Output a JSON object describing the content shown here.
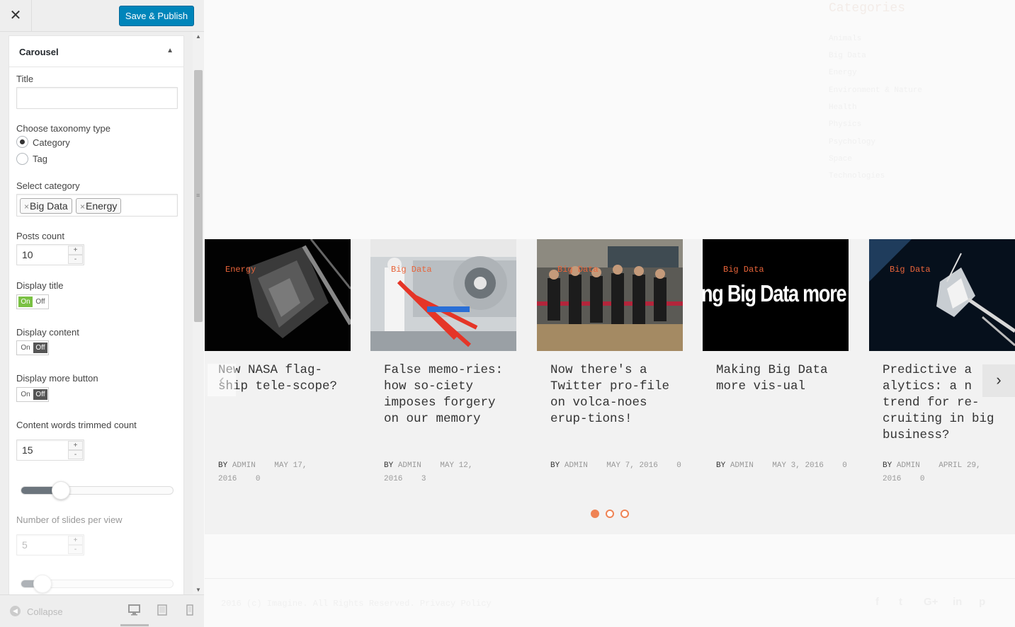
{
  "topbar": {
    "close_icon": "close-icon",
    "save_label": "Save & Publish"
  },
  "widget": {
    "title": "Carousel",
    "fields": {
      "title_label": "Title",
      "title_value": "",
      "taxonomy_label": "Choose taxonomy type",
      "taxonomy_options": [
        "Category",
        "Tag"
      ],
      "taxonomy_selected": "Category",
      "category_label": "Select category",
      "categories_selected": [
        "Big Data",
        "Energy"
      ],
      "posts_count_label": "Posts count",
      "posts_count_value": "10",
      "display_title_label": "Display title",
      "display_title": "On",
      "display_content_label": "Display content",
      "display_content": "Off",
      "display_more_label": "Display more button",
      "display_more": "Off",
      "words_count_label": "Content words trimmed count",
      "words_count_value": "15",
      "words_slider_level": 0.26,
      "slides_per_view_label": "Number of slides per view",
      "slides_per_view_value": "5",
      "slides_slider_level": 0.14,
      "toggle_on": "On",
      "toggle_off": "Off",
      "spin_plus": "+",
      "spin_minus": "-"
    }
  },
  "bottombar": {
    "collapse_label": "Collapse",
    "devices": [
      "desktop-icon",
      "tablet-icon",
      "mobile-icon"
    ]
  },
  "preview": {
    "categories_title": "Categories",
    "categories": [
      "Animals",
      "Big Data",
      "Energy",
      "Environment & Nature",
      "Health",
      "Physics",
      "Psychology",
      "Space",
      "Technologies"
    ],
    "slides": [
      {
        "badge": "Energy",
        "title": "New NASA flag-ship tele-scope?",
        "by": "BY",
        "author": "ADMIN",
        "date": "MAY 17, 2016",
        "comments": "0"
      },
      {
        "badge": "Big Data",
        "title": "False memo-ries: how so-ciety imposes forgery on our memory",
        "by": "BY",
        "author": "ADMIN",
        "date": "MAY 12, 2016",
        "comments": "3"
      },
      {
        "badge": "Big Data",
        "title": "Now there's a Twitter pro-file on volca-noes erup-tions!",
        "by": "BY",
        "author": "ADMIN",
        "date": "MAY 7, 2016",
        "comments": "0"
      },
      {
        "badge": "Big Data",
        "image_text": "ng Big Data more v",
        "title": "Making Big Data more vis-ual",
        "by": "BY",
        "author": "ADMIN",
        "date": "MAY 3, 2016",
        "comments": "0"
      },
      {
        "badge": "Big Data",
        "title": "Predictive a alytics: a n trend for re-cruiting in big business?",
        "by": "BY",
        "author": "ADMIN",
        "date": "APRIL 29, 2016",
        "comments": "0"
      }
    ],
    "pagination": {
      "pages": 3,
      "active": 1
    },
    "footer": {
      "copyright": "2016 (c) Imagine. All Rights Reserved.   Privacy Policy",
      "social": [
        "facebook-icon",
        "twitter-icon",
        "google-plus-icon",
        "linkedin-icon",
        "pinterest-icon"
      ],
      "social_glyphs": [
        "f",
        "t",
        "G+",
        "in",
        "p"
      ]
    },
    "colors": {
      "accent": "#ef8354",
      "button": "#0085ba"
    }
  }
}
